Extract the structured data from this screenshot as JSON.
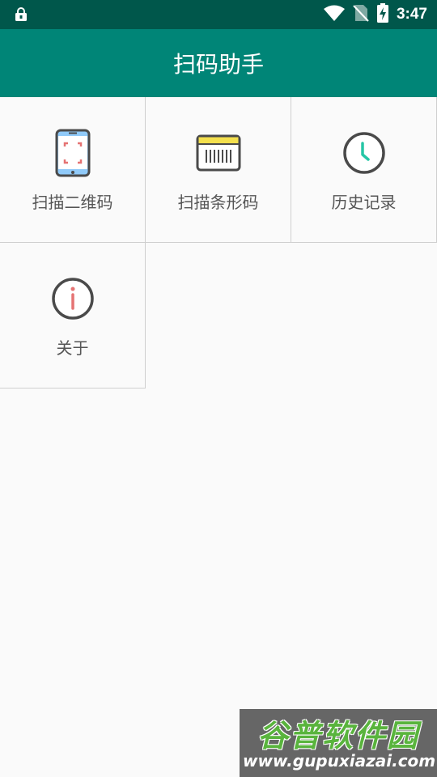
{
  "status_bar": {
    "time": "3:47",
    "icons": [
      "lock-icon",
      "wifi-icon",
      "no-sim-icon",
      "battery-charging-icon"
    ]
  },
  "app_bar": {
    "title": "扫码助手"
  },
  "menu": {
    "items": [
      {
        "label": "扫描二维码",
        "icon": "phone-qr-scan-icon"
      },
      {
        "label": "扫描条形码",
        "icon": "barcode-icon"
      },
      {
        "label": "历史记录",
        "icon": "clock-icon"
      },
      {
        "label": "关于",
        "icon": "info-icon"
      }
    ]
  },
  "watermark": {
    "brand": "谷普软件园",
    "url": "www.gupuxiazai.com"
  },
  "colors": {
    "status_bar": "#00574b",
    "app_bar": "#008577",
    "background": "#fafafa",
    "icon_outline": "#4a4a4a",
    "accent_red": "#e57373",
    "accent_blue": "#90caf9",
    "accent_yellow": "#f4e04d",
    "accent_teal": "#26c6a6"
  }
}
